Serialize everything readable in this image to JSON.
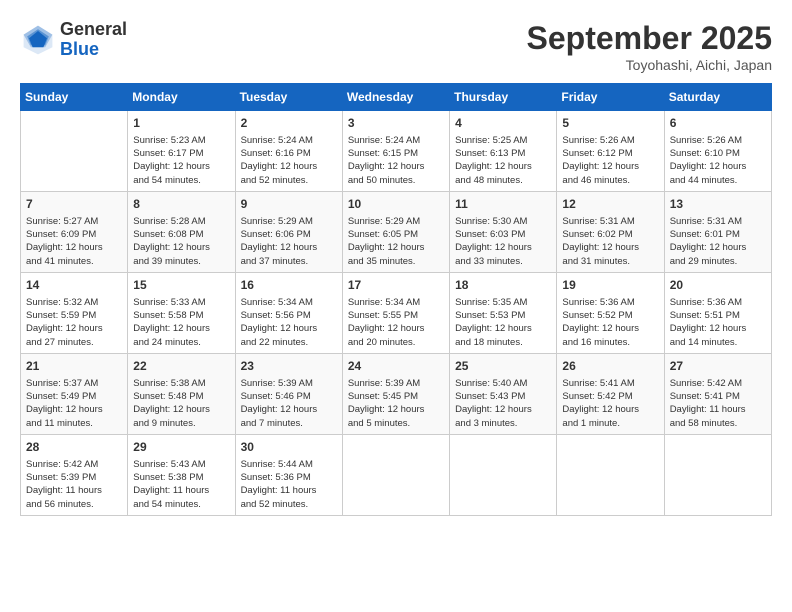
{
  "header": {
    "logo_general": "General",
    "logo_blue": "Blue",
    "title": "September 2025",
    "location": "Toyohashi, Aichi, Japan"
  },
  "days_of_week": [
    "Sunday",
    "Monday",
    "Tuesday",
    "Wednesday",
    "Thursday",
    "Friday",
    "Saturday"
  ],
  "weeks": [
    [
      {
        "day": "",
        "info": ""
      },
      {
        "day": "1",
        "info": "Sunrise: 5:23 AM\nSunset: 6:17 PM\nDaylight: 12 hours\nand 54 minutes."
      },
      {
        "day": "2",
        "info": "Sunrise: 5:24 AM\nSunset: 6:16 PM\nDaylight: 12 hours\nand 52 minutes."
      },
      {
        "day": "3",
        "info": "Sunrise: 5:24 AM\nSunset: 6:15 PM\nDaylight: 12 hours\nand 50 minutes."
      },
      {
        "day": "4",
        "info": "Sunrise: 5:25 AM\nSunset: 6:13 PM\nDaylight: 12 hours\nand 48 minutes."
      },
      {
        "day": "5",
        "info": "Sunrise: 5:26 AM\nSunset: 6:12 PM\nDaylight: 12 hours\nand 46 minutes."
      },
      {
        "day": "6",
        "info": "Sunrise: 5:26 AM\nSunset: 6:10 PM\nDaylight: 12 hours\nand 44 minutes."
      }
    ],
    [
      {
        "day": "7",
        "info": "Sunrise: 5:27 AM\nSunset: 6:09 PM\nDaylight: 12 hours\nand 41 minutes."
      },
      {
        "day": "8",
        "info": "Sunrise: 5:28 AM\nSunset: 6:08 PM\nDaylight: 12 hours\nand 39 minutes."
      },
      {
        "day": "9",
        "info": "Sunrise: 5:29 AM\nSunset: 6:06 PM\nDaylight: 12 hours\nand 37 minutes."
      },
      {
        "day": "10",
        "info": "Sunrise: 5:29 AM\nSunset: 6:05 PM\nDaylight: 12 hours\nand 35 minutes."
      },
      {
        "day": "11",
        "info": "Sunrise: 5:30 AM\nSunset: 6:03 PM\nDaylight: 12 hours\nand 33 minutes."
      },
      {
        "day": "12",
        "info": "Sunrise: 5:31 AM\nSunset: 6:02 PM\nDaylight: 12 hours\nand 31 minutes."
      },
      {
        "day": "13",
        "info": "Sunrise: 5:31 AM\nSunset: 6:01 PM\nDaylight: 12 hours\nand 29 minutes."
      }
    ],
    [
      {
        "day": "14",
        "info": "Sunrise: 5:32 AM\nSunset: 5:59 PM\nDaylight: 12 hours\nand 27 minutes."
      },
      {
        "day": "15",
        "info": "Sunrise: 5:33 AM\nSunset: 5:58 PM\nDaylight: 12 hours\nand 24 minutes."
      },
      {
        "day": "16",
        "info": "Sunrise: 5:34 AM\nSunset: 5:56 PM\nDaylight: 12 hours\nand 22 minutes."
      },
      {
        "day": "17",
        "info": "Sunrise: 5:34 AM\nSunset: 5:55 PM\nDaylight: 12 hours\nand 20 minutes."
      },
      {
        "day": "18",
        "info": "Sunrise: 5:35 AM\nSunset: 5:53 PM\nDaylight: 12 hours\nand 18 minutes."
      },
      {
        "day": "19",
        "info": "Sunrise: 5:36 AM\nSunset: 5:52 PM\nDaylight: 12 hours\nand 16 minutes."
      },
      {
        "day": "20",
        "info": "Sunrise: 5:36 AM\nSunset: 5:51 PM\nDaylight: 12 hours\nand 14 minutes."
      }
    ],
    [
      {
        "day": "21",
        "info": "Sunrise: 5:37 AM\nSunset: 5:49 PM\nDaylight: 12 hours\nand 11 minutes."
      },
      {
        "day": "22",
        "info": "Sunrise: 5:38 AM\nSunset: 5:48 PM\nDaylight: 12 hours\nand 9 minutes."
      },
      {
        "day": "23",
        "info": "Sunrise: 5:39 AM\nSunset: 5:46 PM\nDaylight: 12 hours\nand 7 minutes."
      },
      {
        "day": "24",
        "info": "Sunrise: 5:39 AM\nSunset: 5:45 PM\nDaylight: 12 hours\nand 5 minutes."
      },
      {
        "day": "25",
        "info": "Sunrise: 5:40 AM\nSunset: 5:43 PM\nDaylight: 12 hours\nand 3 minutes."
      },
      {
        "day": "26",
        "info": "Sunrise: 5:41 AM\nSunset: 5:42 PM\nDaylight: 12 hours\nand 1 minute."
      },
      {
        "day": "27",
        "info": "Sunrise: 5:42 AM\nSunset: 5:41 PM\nDaylight: 11 hours\nand 58 minutes."
      }
    ],
    [
      {
        "day": "28",
        "info": "Sunrise: 5:42 AM\nSunset: 5:39 PM\nDaylight: 11 hours\nand 56 minutes."
      },
      {
        "day": "29",
        "info": "Sunrise: 5:43 AM\nSunset: 5:38 PM\nDaylight: 11 hours\nand 54 minutes."
      },
      {
        "day": "30",
        "info": "Sunrise: 5:44 AM\nSunset: 5:36 PM\nDaylight: 11 hours\nand 52 minutes."
      },
      {
        "day": "",
        "info": ""
      },
      {
        "day": "",
        "info": ""
      },
      {
        "day": "",
        "info": ""
      },
      {
        "day": "",
        "info": ""
      }
    ]
  ]
}
